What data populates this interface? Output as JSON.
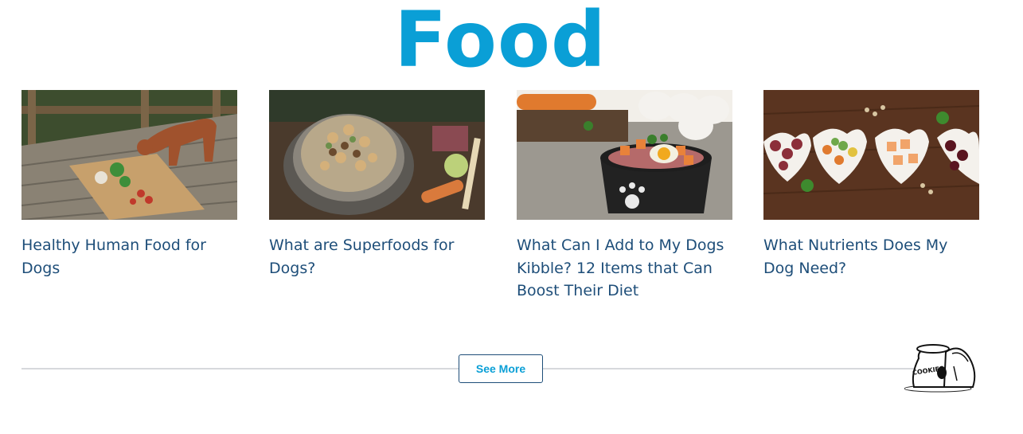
{
  "section": {
    "title": "Food",
    "title_color": "#0a9fd6",
    "article_title_color": "#1e4e79",
    "button_text_color": "#0a9fd6"
  },
  "articles": [
    {
      "title": "Healthy Human Food for Dogs",
      "image": "dog-on-wooden-deck-with-food-platter"
    },
    {
      "title": "What are Superfoods for Dogs?",
      "image": "bowl-of-dog-kibble-with-vegetables"
    },
    {
      "title": "What Can I Add to My Dogs Kibble? 12 Items that Can Boost Their Diet",
      "image": "dog-bowl-with-meat-carrots-and-egg"
    },
    {
      "title": "What Nutrients Does My Dog Need?",
      "image": "heart-shaped-bowls-of-meat-and-vegetables"
    }
  ],
  "see_more": {
    "label": "See More"
  },
  "mascot": {
    "jar_label": "COOKIES",
    "icon": "cookie-jar-dog-illustration"
  }
}
